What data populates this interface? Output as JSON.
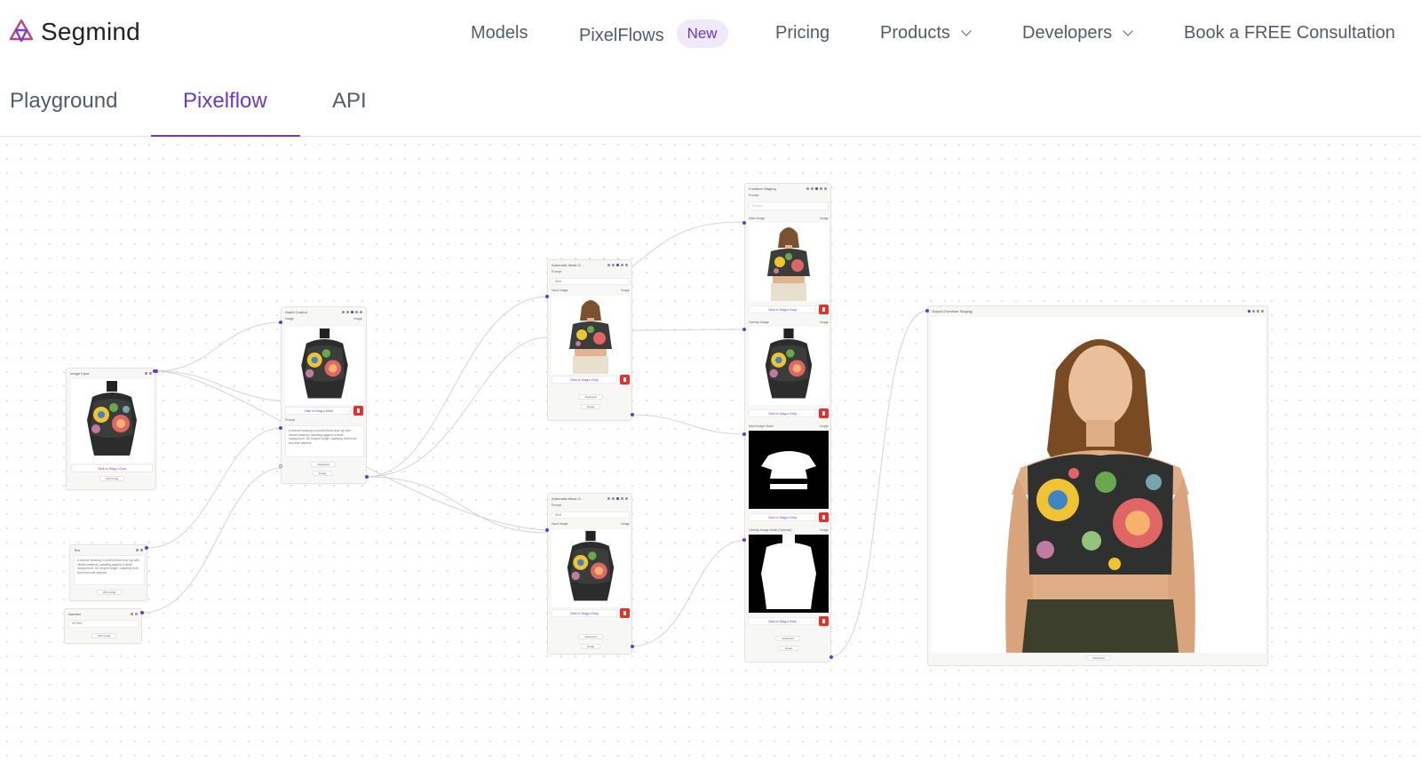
{
  "header": {
    "brand": "Segmind",
    "nav": [
      {
        "label": "Models"
      },
      {
        "label": "PixelFlows",
        "badge": "New"
      },
      {
        "label": "Pricing"
      },
      {
        "label": "Products"
      },
      {
        "label": "Developers"
      },
      {
        "label": "Book a FREE Consultation"
      }
    ]
  },
  "tabs": {
    "items": [
      "Playground",
      "Pixelflow",
      "API"
    ],
    "active": "Pixelflow"
  },
  "colors": {
    "accent": "#6a38d6",
    "danger": "#e5302b",
    "brand_logo": "#c0457a"
  },
  "nodes": {
    "image_input": {
      "title": "Image Input",
      "upload": "Click or Drag-n-Drop",
      "config": "API Config"
    },
    "text": {
      "title": "Text",
      "value": "A woman wearing a colorful floral crop top with vibrant patterns, standing against a white background. 3D Degree Angle Capturing both front and side aspects",
      "config": "API Config"
    },
    "number": {
      "title": "Number",
      "value": "507852",
      "config": "API Config"
    },
    "control": {
      "title": "Depth Control",
      "image_label": "Image",
      "image_type": "Image",
      "upload": "Click or Drag-n-Drop",
      "prompt_label": "Prompt",
      "prompt": "A woman wearing a colorful floral crop top with vibrant patterns, standing against a white background. 3D Degree Angle Capturing both front and side aspects",
      "advanced": "Advanced",
      "output": "Image"
    },
    "mask_top": {
      "title": "Automatic Mask G...",
      "prompt_label": "Prompt",
      "prompt": "Shirt",
      "image_label": "Input Image",
      "image_type": "Image",
      "upload": "Click or Drag-n-Drop",
      "advanced": "Advanced",
      "output": "Image"
    },
    "mask_bottom": {
      "title": "Automatic Mask G...",
      "prompt_label": "Prompt",
      "prompt": "Shirt",
      "image_label": "Input Image",
      "image_type": "Image",
      "upload": "Click or Drag-n-Drop",
      "advanced": "Advanced",
      "output": "Image"
    },
    "staging": {
      "title": "Furniture Staging",
      "prompt_label": "Prompt",
      "prompt_placeholder": "Prompt",
      "main_image_label": "Main Image",
      "overlay_image_label": "Overlay Image",
      "main_mask_label": "Main Image Mask",
      "overlay_mask_label": "Overlay Image Mask (Optional)",
      "image_type": "Image",
      "upload": "Click or Drag-n-Drop",
      "advanced": "Advanced",
      "output": "Image"
    },
    "output": {
      "title": "Output (Furniture Staging)",
      "advanced": "Advanced"
    }
  }
}
